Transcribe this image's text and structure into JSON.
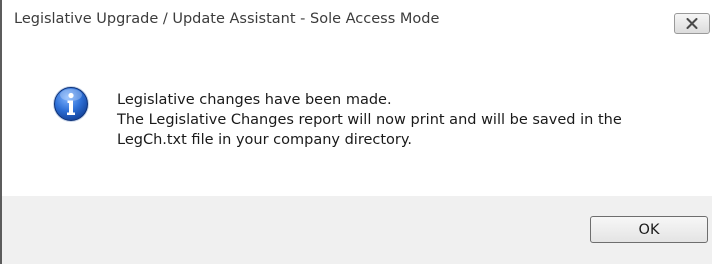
{
  "window": {
    "title": "Legislative Upgrade / Update Assistant - Sole Access Mode"
  },
  "titlebar": {
    "close_icon": "close-icon"
  },
  "message": {
    "icon": "info-icon",
    "lines": [
      "Legislative changes have been made.",
      "The Legislative Changes report will now print and will be saved in the",
      "LegCh.txt file in your company directory."
    ]
  },
  "footer": {
    "ok_label": "OK"
  },
  "colors": {
    "icon_blue": "#1f5fbf",
    "footer_bg": "#f0f0f0"
  }
}
